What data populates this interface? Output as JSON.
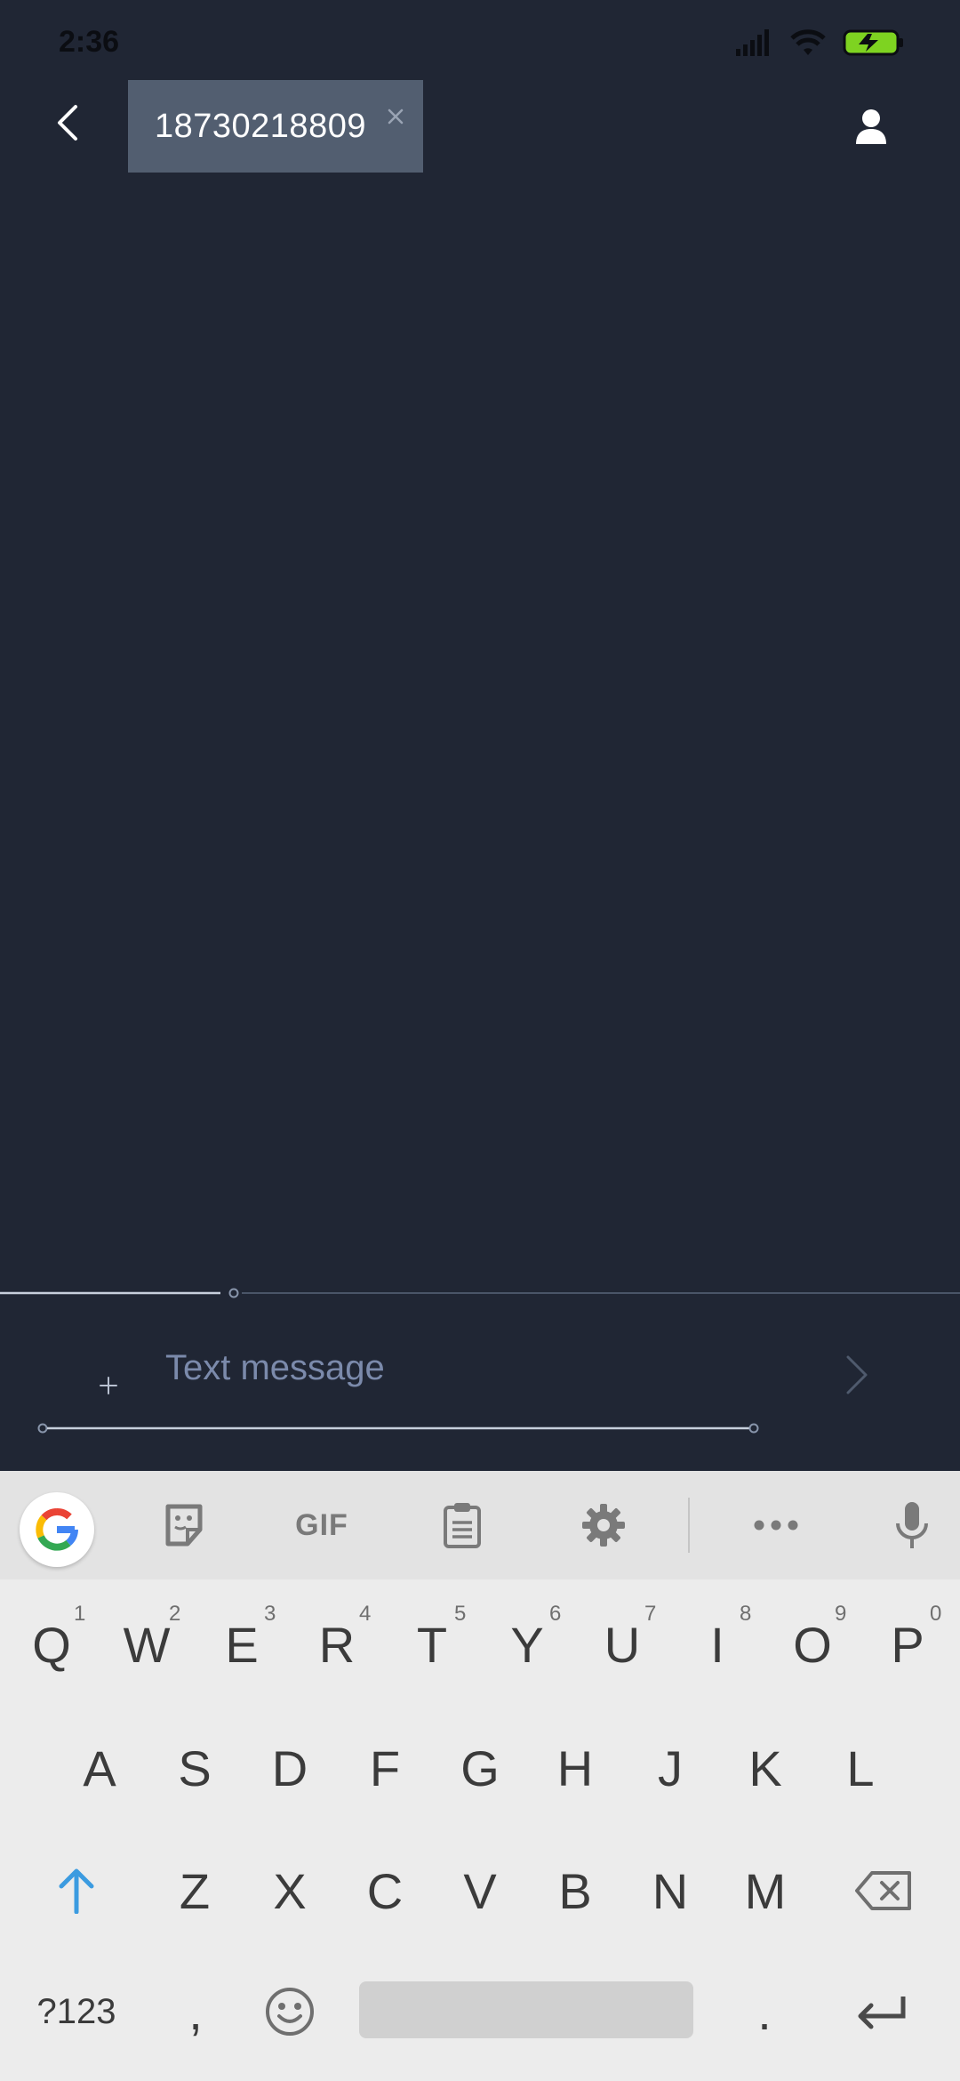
{
  "status_bar": {
    "time": "2:36",
    "icons": [
      "signal-icon",
      "wifi-icon",
      "battery-charging-icon"
    ],
    "battery_color": "#7ed321"
  },
  "header": {
    "recipient_chip": "18730218809",
    "icons": [
      "back-arrow-icon",
      "close-icon",
      "person-icon"
    ]
  },
  "compose": {
    "placeholder": "Text message",
    "icons": [
      "plus-icon",
      "send-chevron-icon"
    ]
  },
  "keyboard": {
    "toolbar": {
      "gif_label": "GIF",
      "icons": [
        "google-g-icon",
        "sticker-icon",
        "clipboard-icon",
        "settings-gear-icon",
        "more-dots-icon",
        "microphone-icon"
      ]
    },
    "row1": [
      {
        "letter": "Q",
        "hint": "1"
      },
      {
        "letter": "W",
        "hint": "2"
      },
      {
        "letter": "E",
        "hint": "3"
      },
      {
        "letter": "R",
        "hint": "4"
      },
      {
        "letter": "T",
        "hint": "5"
      },
      {
        "letter": "Y",
        "hint": "6"
      },
      {
        "letter": "U",
        "hint": "7"
      },
      {
        "letter": "I",
        "hint": "8"
      },
      {
        "letter": "O",
        "hint": "9"
      },
      {
        "letter": "P",
        "hint": "0"
      }
    ],
    "row2": [
      "A",
      "S",
      "D",
      "F",
      "G",
      "H",
      "J",
      "K",
      "L"
    ],
    "row3": [
      "Z",
      "X",
      "C",
      "V",
      "B",
      "N",
      "M"
    ],
    "row4": {
      "symbols_label": "?123",
      "comma": ",",
      "period": "."
    },
    "accent_color": "#3b9be0"
  }
}
